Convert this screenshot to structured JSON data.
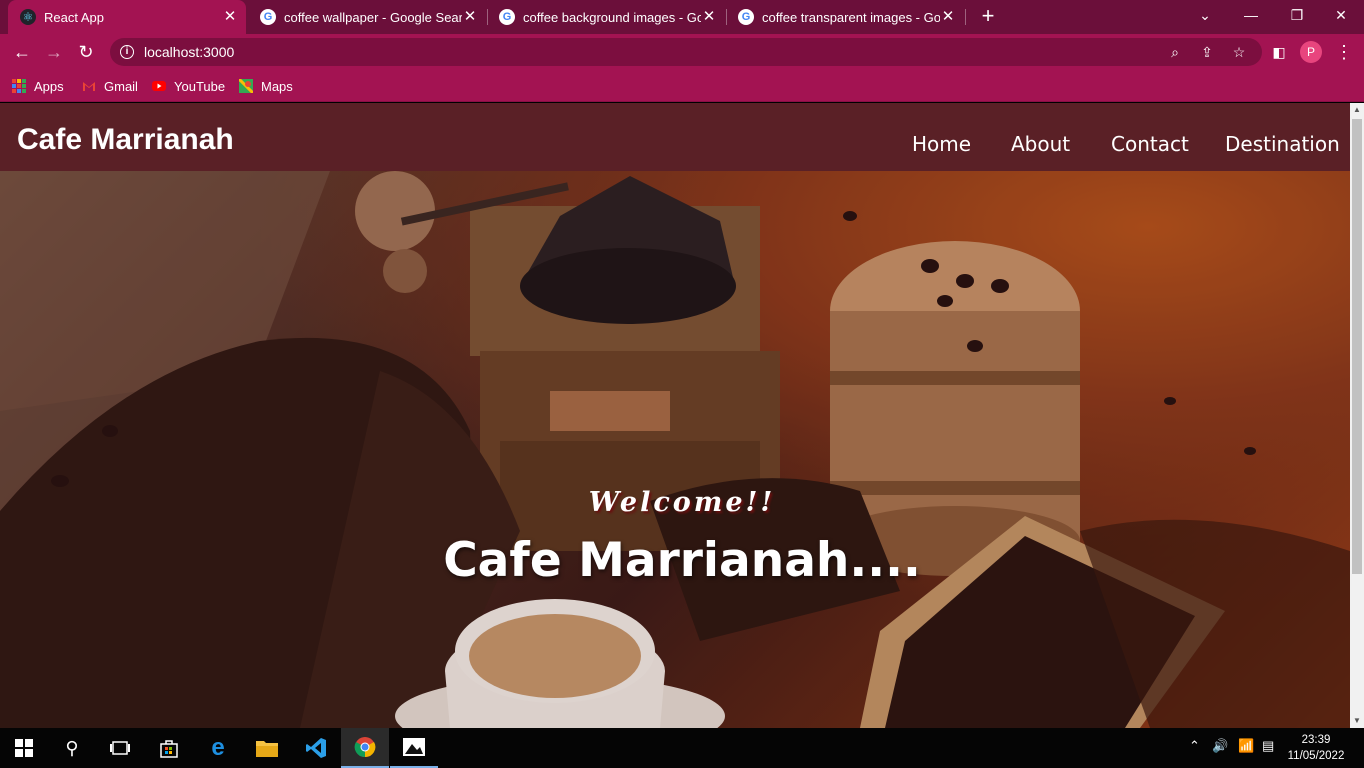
{
  "browser": {
    "tabs": [
      {
        "title": "React App",
        "icon": "react-icon",
        "active": true
      },
      {
        "title": "coffee wallpaper - Google Search",
        "icon": "google-icon",
        "active": false
      },
      {
        "title": "coffee background images - Goo",
        "icon": "google-icon",
        "active": false
      },
      {
        "title": "coffee transparent images - Goo",
        "icon": "google-icon",
        "active": false
      }
    ],
    "url": "localhost:3000",
    "profile_initial": "P",
    "bookmarks": [
      {
        "label": "Apps"
      },
      {
        "label": "Gmail"
      },
      {
        "label": "YouTube"
      },
      {
        "label": "Maps"
      }
    ]
  },
  "page": {
    "brand": "Cafe Marrianah",
    "nav": [
      "Home",
      "About",
      "Contact",
      "Destination"
    ],
    "hero": {
      "welcome": "Welcome!!",
      "title": "Cafe Marrianah...."
    }
  },
  "taskbar": {
    "time": "23:39",
    "date": "11/05/2022"
  },
  "colors": {
    "tabstrip": "#6b0f3a",
    "toolbar": "#a31352",
    "navbar": "#5a2026"
  }
}
